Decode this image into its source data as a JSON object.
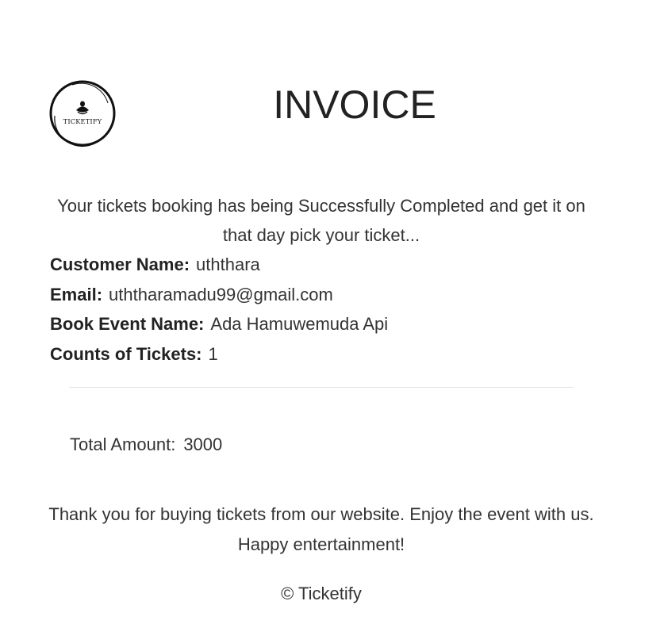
{
  "logo": {
    "icon": "ticketify-logo-icon",
    "text": "TICKETIFY"
  },
  "header": {
    "title": "INVOICE"
  },
  "message": {
    "intro": "Your tickets booking has being Successfully Completed and get it on that day pick your ticket..."
  },
  "details": {
    "customer_name_label": "Customer Name:",
    "customer_name": "uththara",
    "email_label": "Email:",
    "email": "uththaramadu99@gmail.com",
    "event_label": "Book Event Name:",
    "event": "Ada Hamuwemuda Api",
    "tickets_label": "Counts of Tickets:",
    "tickets": "1"
  },
  "summary": {
    "total_label": "Total Amount:",
    "total_value": "3000"
  },
  "closing": {
    "thanks": "Thank you for buying tickets from our website. Enjoy the event with us. Happy entertainment!",
    "copyright": "© Ticketify"
  }
}
